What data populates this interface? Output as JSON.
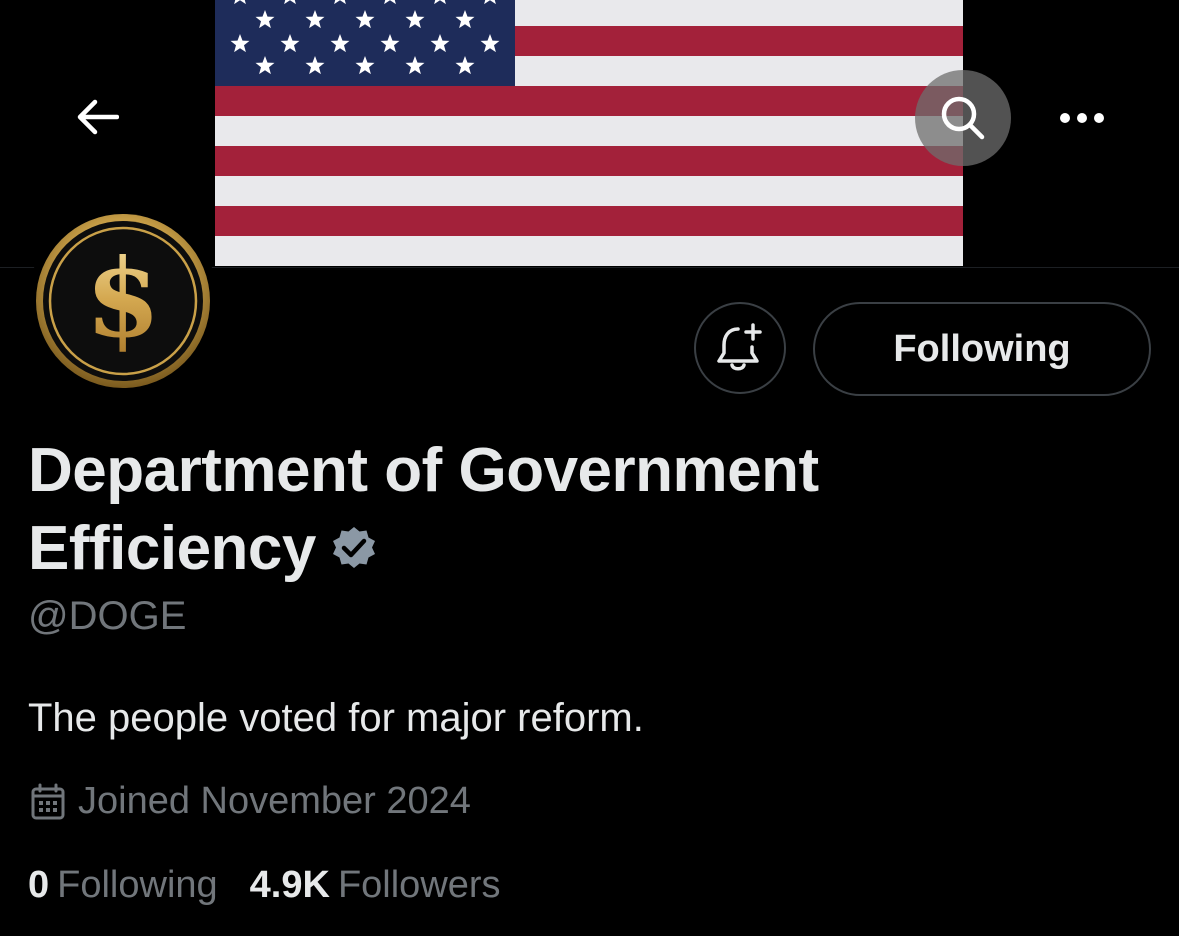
{
  "header": {
    "back_icon": "arrow-left-icon",
    "search_icon": "search-icon",
    "more_icon": "more-horizontal-icon",
    "banner": "american-flag-banner"
  },
  "profile": {
    "avatar": "gold-dollar-coin-avatar",
    "display_name": "Department of Government Efficiency",
    "verified_icon": "verified-badge-icon",
    "handle": "@DOGE",
    "bio": "The people voted for major reform.",
    "joined_icon": "calendar-icon",
    "joined": "Joined November 2024"
  },
  "actions": {
    "notify_icon": "bell-plus-icon",
    "follow_label": "Following"
  },
  "stats": {
    "following_count": "0",
    "following_label": "Following",
    "followers_count": "4.9K",
    "followers_label": "Followers"
  },
  "colors": {
    "background": "#000000",
    "text_primary": "#e7e9ea",
    "text_secondary": "#71767b",
    "border": "#3a3f44",
    "flag_red": "#a3213a",
    "flag_blue": "#1e2c5a",
    "coin_gold": "#c9a048",
    "verified": "#8b98a5"
  }
}
